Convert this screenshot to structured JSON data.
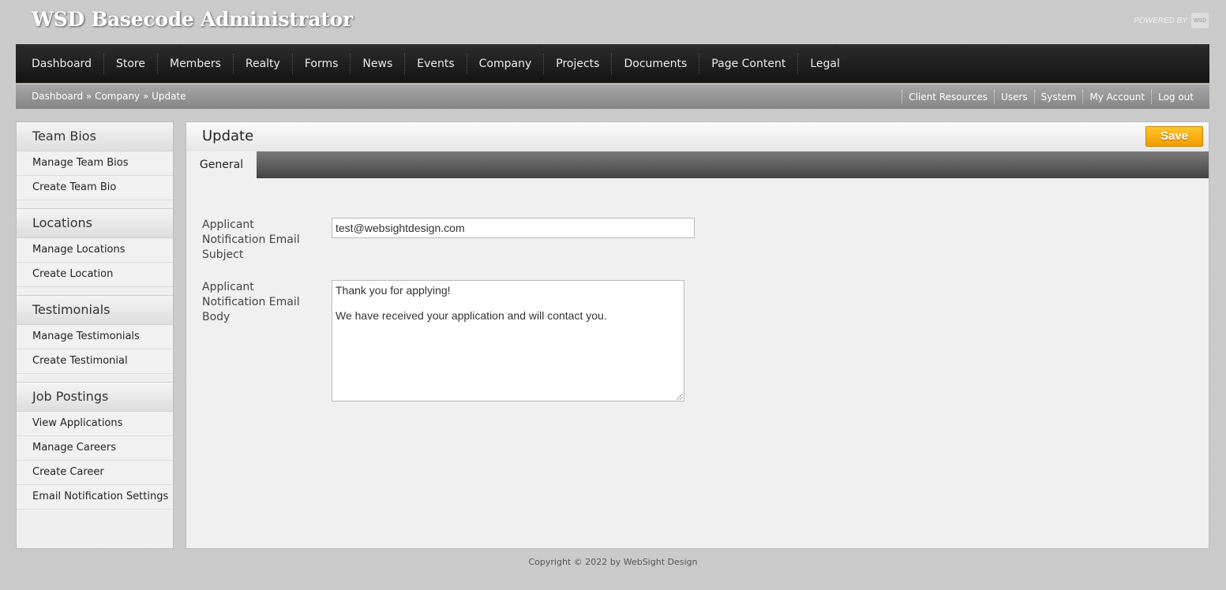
{
  "header": {
    "app_title": "WSD Basecode Administrator",
    "powered_by": "POWERED BY",
    "logo_text": "WSD"
  },
  "nav": {
    "items": [
      "Dashboard",
      "Store",
      "Members",
      "Realty",
      "Forms",
      "News",
      "Events",
      "Company",
      "Projects",
      "Documents",
      "Page Content",
      "Legal"
    ]
  },
  "breadcrumb": "Dashboard » Company » Update",
  "util_links": [
    "Client Resources",
    "Users",
    "System",
    "My Account",
    "Log out"
  ],
  "sidebar": {
    "sections": [
      {
        "heading": "Team Bios",
        "items": [
          "Manage Team Bios",
          "Create Team Bio"
        ]
      },
      {
        "heading": "Locations",
        "items": [
          "Manage Locations",
          "Create Location"
        ]
      },
      {
        "heading": "Testimonials",
        "items": [
          "Manage Testimonials",
          "Create Testimonial"
        ]
      },
      {
        "heading": "Job Postings",
        "items": [
          "View Applications",
          "Manage Careers",
          "Create Career",
          "Email Notification Settings"
        ]
      }
    ]
  },
  "main": {
    "title": "Update",
    "save_label": "Save",
    "tab_general": "General",
    "form": {
      "subject_label": "Applicant Notification Email Subject",
      "subject_value": "test@websightdesign.com",
      "body_label": "Applicant Notification Email Body",
      "body_value": "Thank you for applying!\n\nWe have received your application and will contact you."
    }
  },
  "footer": {
    "copyright": "Copyright © 2022 by WebSight Design"
  },
  "colors": {
    "accent": "#f5a500",
    "nav_bg": "#1f1f1f",
    "nav_underline": "#b8913a"
  }
}
